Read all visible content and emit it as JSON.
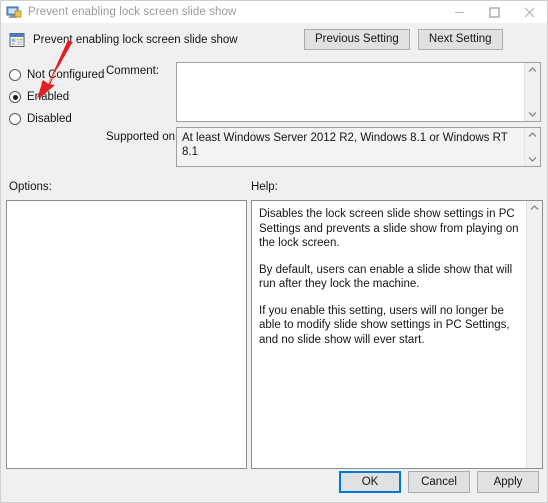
{
  "window": {
    "title": "Prevent enabling lock screen slide show",
    "titlebar_icon": "policy-monitor-icon",
    "controls": {
      "minimize": "minimize-icon",
      "maximize": "maximize-icon",
      "close": "close-icon"
    }
  },
  "header": {
    "icon": "policy-setting-icon",
    "policy_name": "Prevent enabling lock screen slide show",
    "previous_setting": "Previous Setting",
    "next_setting": "Next Setting"
  },
  "state_options": {
    "not_configured": {
      "label": "Not Configured",
      "selected": false
    },
    "enabled": {
      "label": "Enabled",
      "selected": true
    },
    "disabled": {
      "label": "Disabled",
      "selected": false
    }
  },
  "comment": {
    "label": "Comment:",
    "value": ""
  },
  "supported_on": {
    "label": "Supported on:",
    "value": "At least Windows Server 2012 R2, Windows 8.1 or Windows RT 8.1"
  },
  "options": {
    "label": "Options:",
    "content": ""
  },
  "help": {
    "label": "Help:",
    "paragraphs": [
      "Disables the lock screen slide show settings in PC Settings and prevents a slide show from playing on the lock screen.",
      "By default, users can enable a slide show that will run after they lock the machine.",
      "If you enable this setting, users will no longer be able to modify slide show settings in PC Settings, and no slide show will ever start."
    ]
  },
  "footer": {
    "ok": "OK",
    "cancel": "Cancel",
    "apply": "Apply"
  },
  "annotation": {
    "arrow": "red-arrow-pointing-to-enabled",
    "color": "#e02020"
  }
}
